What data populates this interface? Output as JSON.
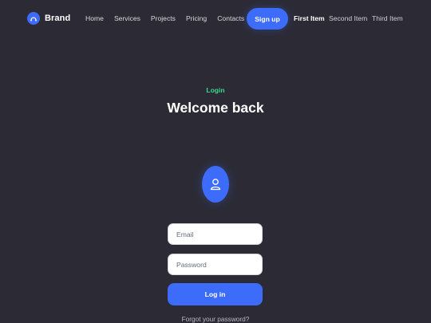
{
  "navbar": {
    "brand": {
      "name": "Brand",
      "icon": "bezier-curve-icon",
      "accent": "#3d6bfa"
    },
    "links": [
      {
        "label": "Home"
      },
      {
        "label": "Services"
      },
      {
        "label": "Projects"
      },
      {
        "label": "Pricing"
      },
      {
        "label": "Contacts"
      }
    ],
    "signup_label": "Sign up",
    "extra_items": [
      {
        "label": "First Item",
        "active": true
      },
      {
        "label": "Second Item",
        "active": false
      },
      {
        "label": "Third Item",
        "active": false
      }
    ]
  },
  "hero": {
    "eyebrow": "Login",
    "title": "Welcome back",
    "avatar_icon": "user-icon"
  },
  "form": {
    "email": {
      "placeholder": "Email",
      "value": ""
    },
    "password": {
      "placeholder": "Password",
      "value": ""
    },
    "submit_label": "Log in",
    "forgot_label": "Forgot your password?"
  },
  "colors": {
    "background": "#2c2b35",
    "primary": "#3d6bfa",
    "eyebrow": "#39d98a"
  }
}
